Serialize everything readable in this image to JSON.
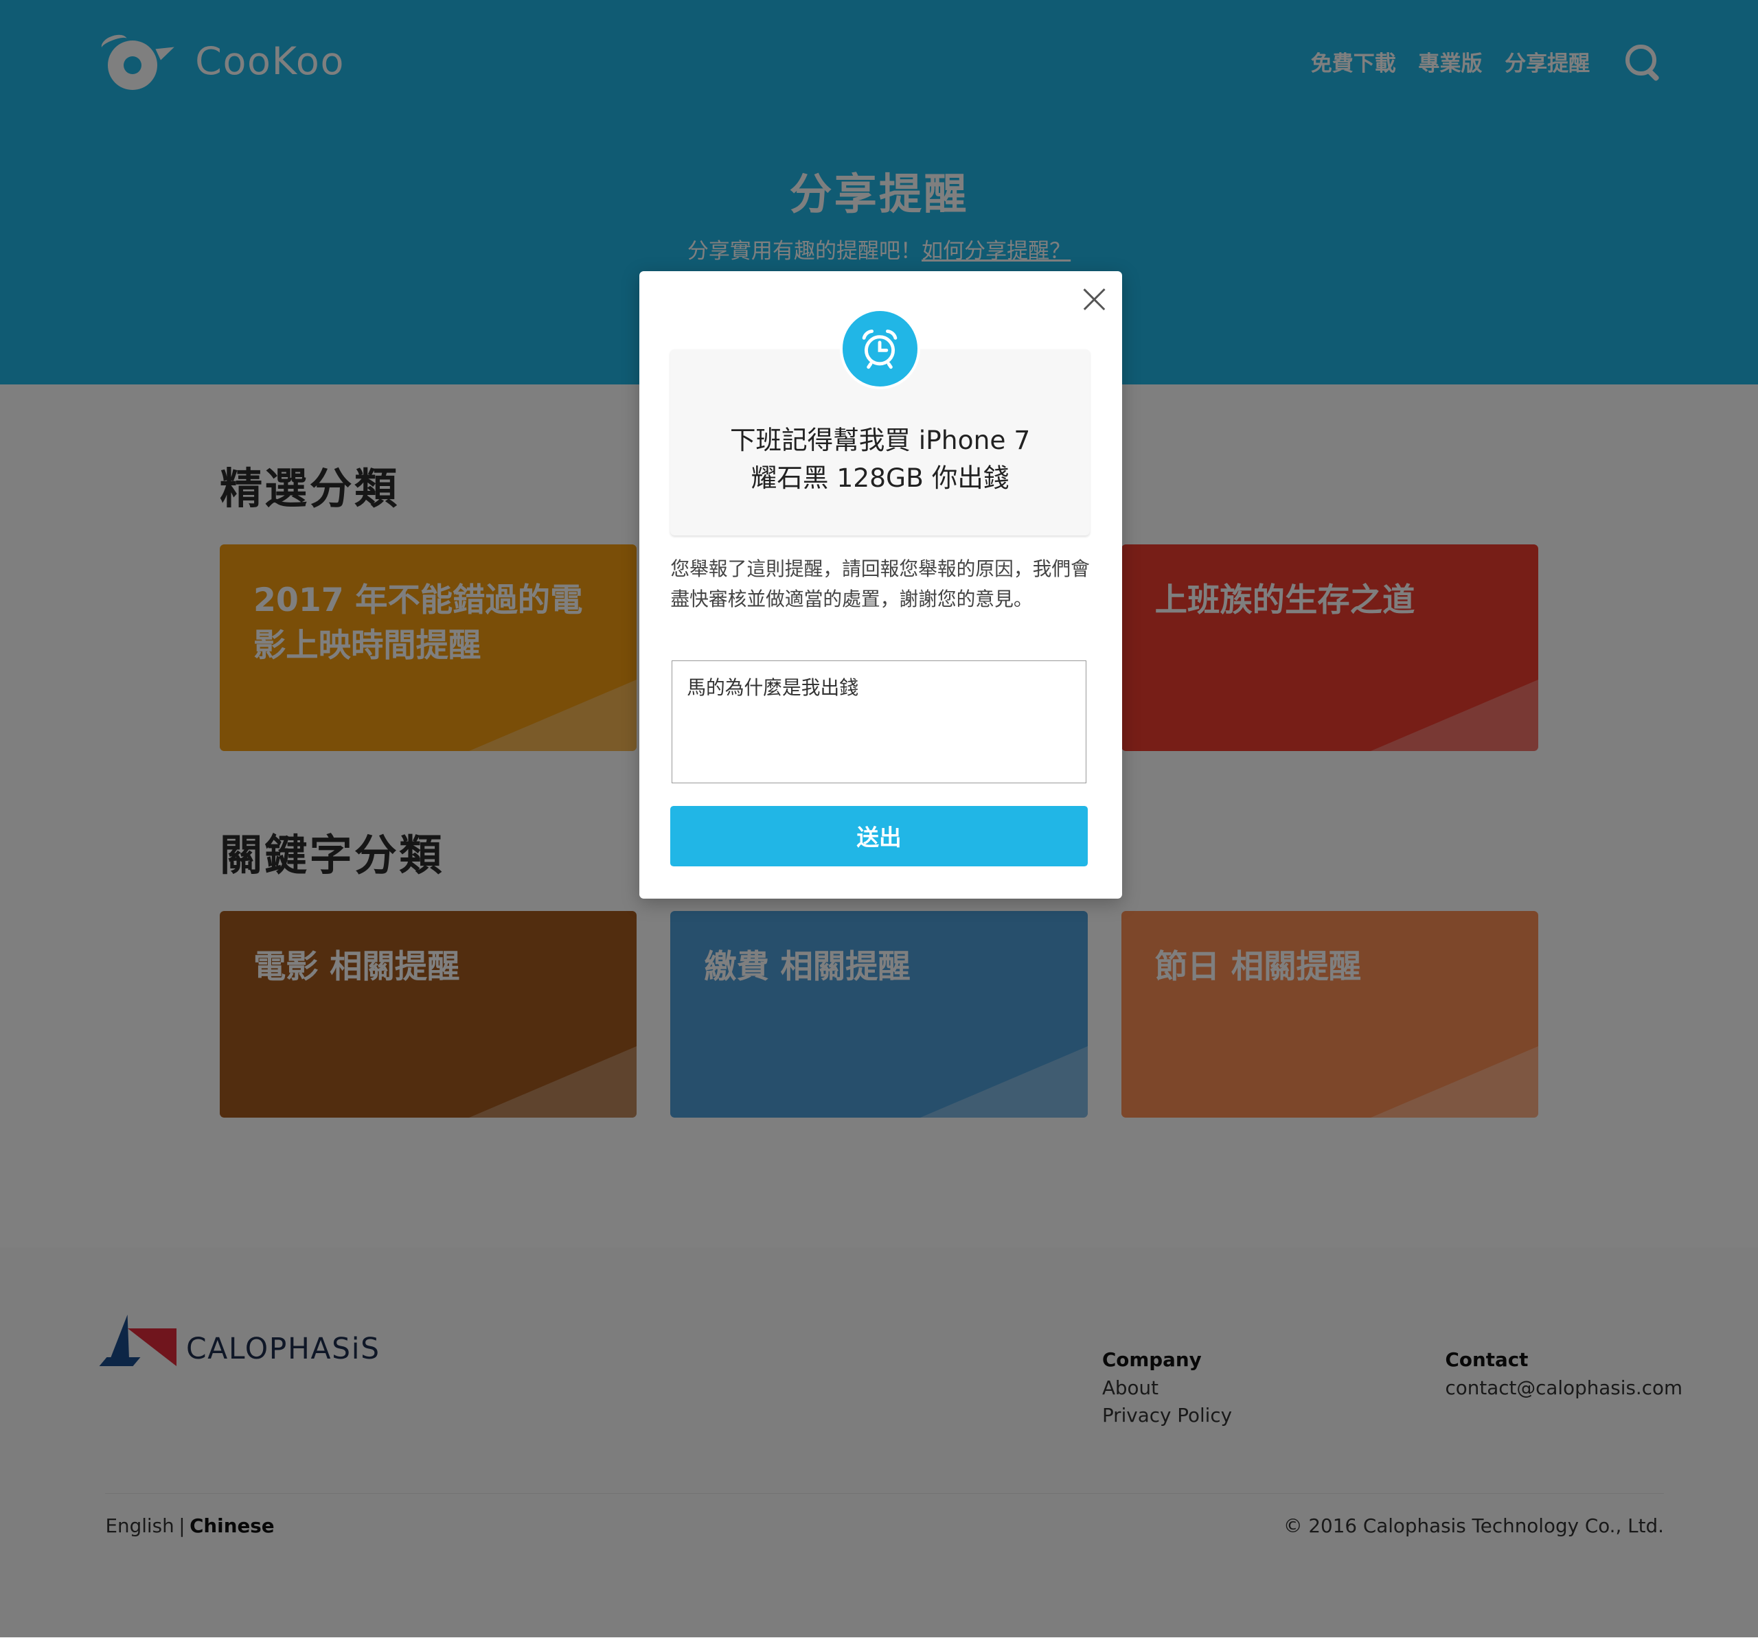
{
  "header": {
    "logo_text": "CooKoo",
    "nav": [
      "免費下載",
      "專業版",
      "分享提醒"
    ],
    "search_icon": "search-icon"
  },
  "hero": {
    "title": "分享提醒",
    "subtitle": "分享實用有趣的提醒吧！",
    "how_link": "如何分享提醒？",
    "background": "#21b6e6"
  },
  "featured": {
    "title": "精選分類",
    "cards": [
      {
        "label": "2017 年不能錯過的電影上映時間提醒",
        "color": "#f49c11"
      },
      {
        "label": "",
        "color": "#3aa56b"
      },
      {
        "label": "上班族的生存之道",
        "color": "#ef3c2e"
      }
    ]
  },
  "keywords": {
    "title": "關鍵字分類",
    "cards": [
      {
        "label": "電影 相關提醒",
        "color": "#a55a1f"
      },
      {
        "label": "繳費 相關提醒",
        "color": "#4f9fd9"
      },
      {
        "label": "節日 相關提醒",
        "color": "#fb8f55"
      }
    ]
  },
  "footer": {
    "brand": "CALOPHASiS",
    "company": {
      "heading": "Company",
      "links": [
        "About",
        "Privacy Policy"
      ]
    },
    "contact": {
      "heading": "Contact",
      "email": "contact@calophasis.com"
    },
    "languages": {
      "english": "English",
      "separator": "|",
      "chinese": "Chinese"
    },
    "copyright": "© 2016 Calophasis Technology Co., Ltd."
  },
  "modal": {
    "icon": "alarm-clock-icon",
    "reminder_line1": "下班記得幫我買 iPhone 7",
    "reminder_line2": "耀石黑 128GB 你出錢",
    "description": "您舉報了這則提醒，請回報您舉報的原因，我們會盡快審核並做適當的處置，謝謝您的意見。",
    "reason_value": "馬的為什麼是我出錢",
    "submit_label": "送出"
  }
}
